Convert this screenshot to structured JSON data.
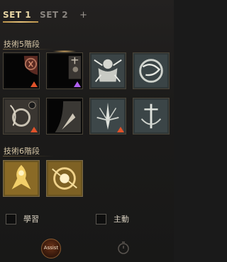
{
  "tabs": {
    "set1": "SET 1",
    "set2": "SET 2",
    "add": "+"
  },
  "sections": {
    "tier5": "技術5階段",
    "tier6": "技術6階段"
  },
  "checkboxes": {
    "learn": "學習",
    "active": "主動"
  },
  "footer": {
    "assist": "Assist"
  },
  "colors": {
    "accent_gold": "#e6c27a",
    "upgrade_red": "#e0522a",
    "upgrade_purple": "#b060f0"
  }
}
